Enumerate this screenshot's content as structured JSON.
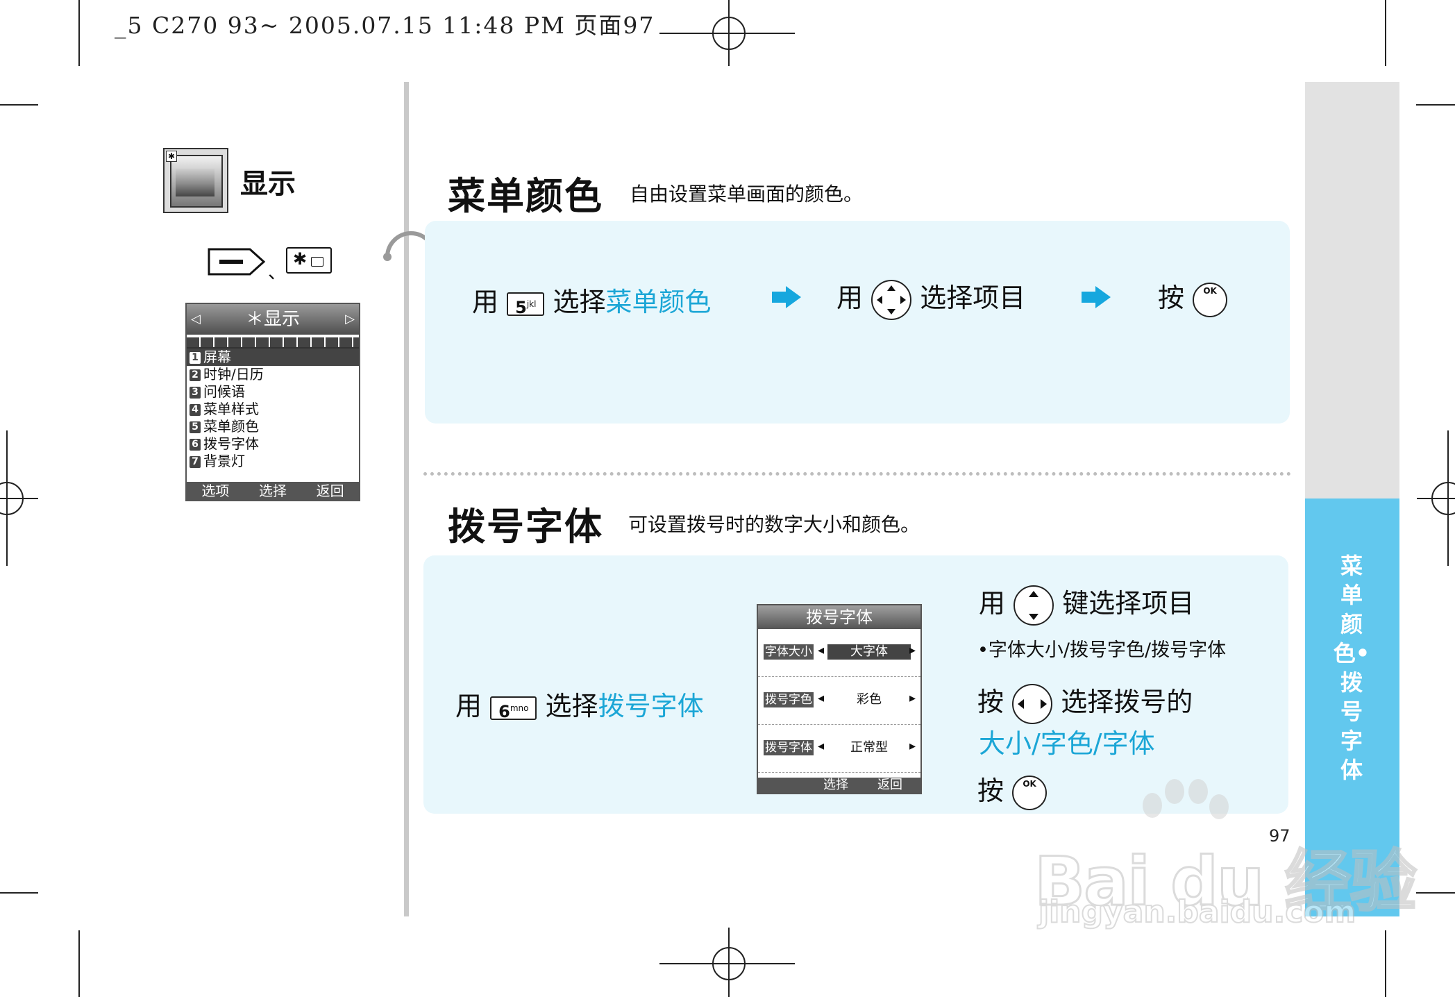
{
  "print_header": "_5 C270 93~ 2005.07.15 11:48 PM 页面97",
  "section": {
    "title": "显示",
    "shortcut_sep": "、",
    "star_key": "✱"
  },
  "display_menu": {
    "title": "＊显示",
    "left_arrow": "◁",
    "right_arrow": "▷",
    "items": [
      {
        "num": "1",
        "label": "屏幕"
      },
      {
        "num": "2",
        "label": "时钟/日历"
      },
      {
        "num": "3",
        "label": "问候语"
      },
      {
        "num": "4",
        "label": "菜单样式"
      },
      {
        "num": "5",
        "label": "菜单颜色"
      },
      {
        "num": "6",
        "label": "拨号字体"
      },
      {
        "num": "7",
        "label": "背景灯"
      }
    ],
    "softkeys": [
      "选项",
      "选择",
      "返回"
    ]
  },
  "menu_color": {
    "title": "菜单颜色",
    "desc": "自由设置菜单画面的颜色。",
    "step1_use": "用",
    "step1_key": "5",
    "step1_key_sup": "jkl",
    "step1_select": "选择",
    "step1_target": "菜单颜色",
    "step2_use": "用",
    "step2_text": "选择项目",
    "step3_press": "按",
    "ok_label": "OK"
  },
  "dial_font": {
    "title": "拨号字体",
    "desc": "可设置拨号时的数字大小和颜色。",
    "step1_use": "用",
    "step1_key": "6",
    "step1_key_sup": "mno",
    "step1_select": "选择",
    "step1_target": "拨号字体",
    "screen": {
      "title": "拨号字体",
      "rows": [
        {
          "label": "字体大小",
          "value": "大字体"
        },
        {
          "label": "拨号字色",
          "value": "彩色"
        },
        {
          "label": "拨号字体",
          "value": "正常型"
        }
      ],
      "softkeys": [
        "选择",
        "返回"
      ]
    },
    "r1_use": "用",
    "r1_text": "键选择项目",
    "r1_bullet": "•字体大小/拨号字色/拨号字体",
    "r2_press": "按",
    "r2_text": "选择拨号的",
    "r2_target": "大小/字色/字体",
    "r3_press": "按",
    "ok_label": "OK"
  },
  "side_tab": {
    "text": "菜单颜色•拨号字体"
  },
  "page_number": "97",
  "watermark": {
    "brand": "Bai du 经验",
    "url": "jingyan.baidu.com"
  }
}
